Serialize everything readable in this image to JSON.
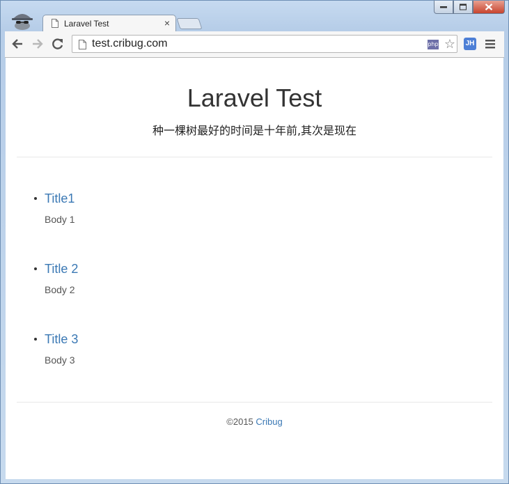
{
  "browser": {
    "tab_title": "Laravel Test",
    "tab_close": "×",
    "url": "test.cribug.com",
    "ext_php": "php",
    "ext_jh": "JH"
  },
  "page": {
    "title": "Laravel Test",
    "subtitle": "种一棵树最好的时间是十年前,其次是现在",
    "posts": [
      {
        "title": "Title1",
        "body": "Body 1"
      },
      {
        "title": "Title 2",
        "body": "Body 2"
      },
      {
        "title": "Title 3",
        "body": "Body 3"
      }
    ],
    "footer": {
      "copyright": "©2015",
      "link_text": "Cribug"
    }
  },
  "icons": {
    "incognito": "incognito-icon",
    "back": "back-arrow-icon",
    "forward": "forward-arrow-icon",
    "reload": "reload-icon",
    "page": "page-icon",
    "star": "star-icon",
    "menu": "hamburger-menu-icon"
  }
}
